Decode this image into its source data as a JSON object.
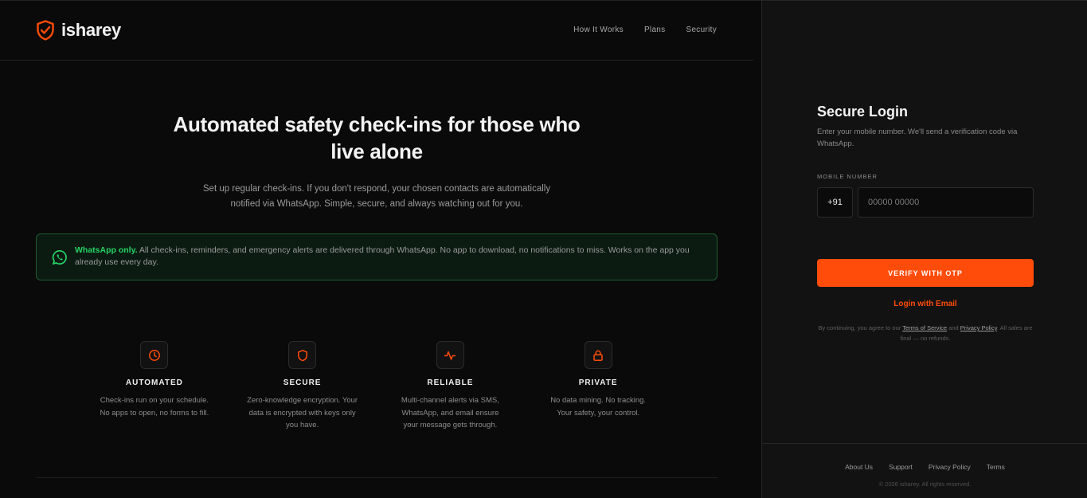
{
  "brand": {
    "name": "isharey",
    "accent": "#ff4c0a"
  },
  "nav": {
    "items": [
      "How It Works",
      "Plans",
      "Security"
    ]
  },
  "hero": {
    "title_line1": "Automated safety check-ins for those who",
    "title_line2": "live alone",
    "subtitle_line1": "Set up regular check-ins. If you don't respond, your chosen contacts are automatically",
    "subtitle_line2": "notified via WhatsApp. Simple, secure, and always watching out for you."
  },
  "whatsapp_notice": {
    "icon": "whatsapp-icon",
    "strong": "WhatsApp only.",
    "text": "All check-ins, reminders, and emergency alerts are delivered through WhatsApp. No app to download, no notifications to miss. Works on the app you already use every day.",
    "color": "#25d366"
  },
  "features": [
    {
      "icon": "clock-icon",
      "title": "AUTOMATED",
      "desc": "Check-ins run on your schedule. No apps to open, no forms to fill."
    },
    {
      "icon": "shield-icon",
      "title": "SECURE",
      "desc": "Zero-knowledge encryption. Your data is encrypted with keys only you have."
    },
    {
      "icon": "pulse-icon",
      "title": "RELIABLE",
      "desc": "Multi-channel alerts via SMS, WhatsApp, and email ensure your message gets through."
    },
    {
      "icon": "lock-icon",
      "title": "PRIVATE",
      "desc": "No data mining. No tracking. Your safety, your control."
    }
  ],
  "login": {
    "title": "Secure Login",
    "subtitle": "Enter your mobile number. We'll send a verification code via WhatsApp.",
    "field_label": "MOBILE NUMBER",
    "country_code": "+91",
    "phone_placeholder": "00000 00000",
    "phone_value": "",
    "verify_label": "VERIFY WITH OTP",
    "email_link": "Login with Email",
    "legal_prefix": "By continuing, you agree to our",
    "terms_link": "Terms of Service",
    "legal_and": "and",
    "privacy_link": "Privacy Policy",
    "legal_suffix": ". All sales are final — no refunds."
  },
  "footer": {
    "links": [
      "About Us",
      "Support",
      "Privacy Policy",
      "Terms"
    ],
    "copyright": "© 2026 isharey. All rights reserved."
  }
}
